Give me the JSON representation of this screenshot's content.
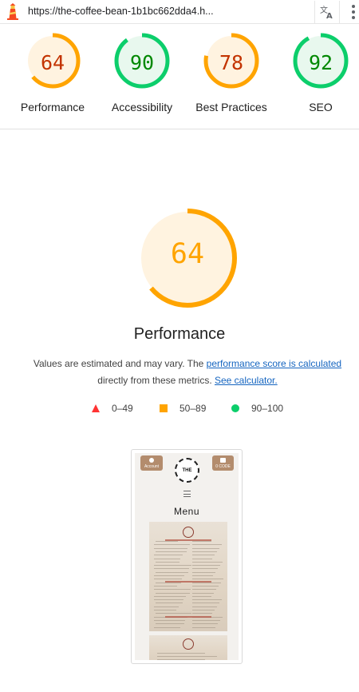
{
  "urlbar": {
    "url": "https://the-coffee-bean-1b1bc662dda4.h...",
    "icons": [
      "lighthouse-icon",
      "translate-icon",
      "more-vert-icon"
    ]
  },
  "categories": [
    {
      "label": "Performance",
      "score": "64",
      "value": 64,
      "color": "#ffa400",
      "text_color": "#c33300",
      "bg": "#fff3e0"
    },
    {
      "label": "Accessibility",
      "score": "90",
      "value": 90,
      "color": "#0cce6b",
      "text_color": "#008800",
      "bg": "#e8f8ee"
    },
    {
      "label": "Best Practices",
      "score": "78",
      "value": 78,
      "color": "#ffa400",
      "text_color": "#c33300",
      "bg": "#fff3e0"
    },
    {
      "label": "SEO",
      "score": "92",
      "value": 92,
      "color": "#0cce6b",
      "text_color": "#008800",
      "bg": "#e8f8ee"
    }
  ],
  "main": {
    "score": "64",
    "value": 64,
    "color": "#ffa400",
    "title": "Performance",
    "desc_prefix": "Values are estimated and may vary. The ",
    "desc_link1": "performance score is calculated",
    "desc_middle": " directly from these metrics. ",
    "desc_link2": "See calculator."
  },
  "legend": [
    {
      "range": "0–49",
      "color": "#ff3333",
      "icon": "fail-triangle-icon"
    },
    {
      "range": "50–89",
      "color": "#ffa400",
      "icon": "average-square-icon"
    },
    {
      "range": "90–100",
      "color": "#0cce6b",
      "icon": "pass-circle-icon"
    }
  ],
  "screenshot": {
    "account_label": "Account",
    "order_label": "0 CODE",
    "logo_text": "THE",
    "menu_title": "Menu"
  }
}
